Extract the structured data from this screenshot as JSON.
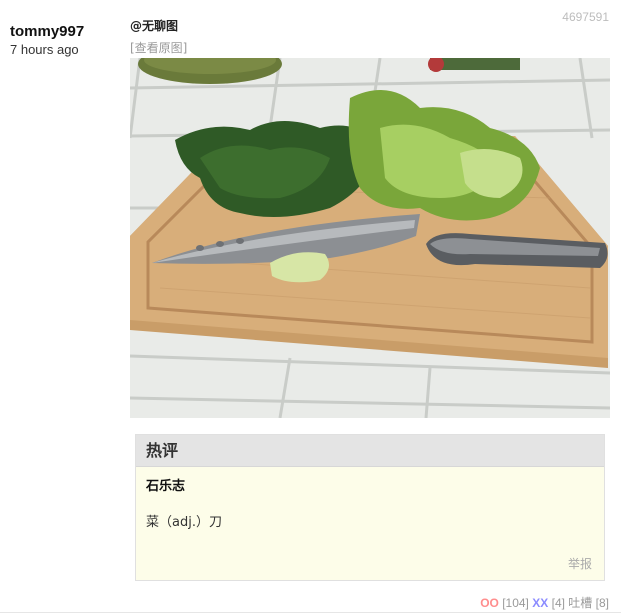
{
  "post": {
    "author": "tommy997",
    "time": "7 hours ago",
    "id": "4697591",
    "mention": "@无聊图",
    "view_original": "[查看原图]",
    "photo_alt": ""
  },
  "hot_comment": {
    "header": "热评",
    "user": "石乐志",
    "text": "菜（adj.）刀",
    "report": "举报"
  },
  "votes": {
    "oo_label": "OO",
    "oo_count": "[104]",
    "xx_label": "XX",
    "xx_count": "[4]",
    "tucao_label": "吐槽",
    "tucao_count": "[8]"
  },
  "colors": {
    "oo": "#ff8d8d",
    "xx": "#8b8bff",
    "hot_bg": "#fdfde9"
  }
}
